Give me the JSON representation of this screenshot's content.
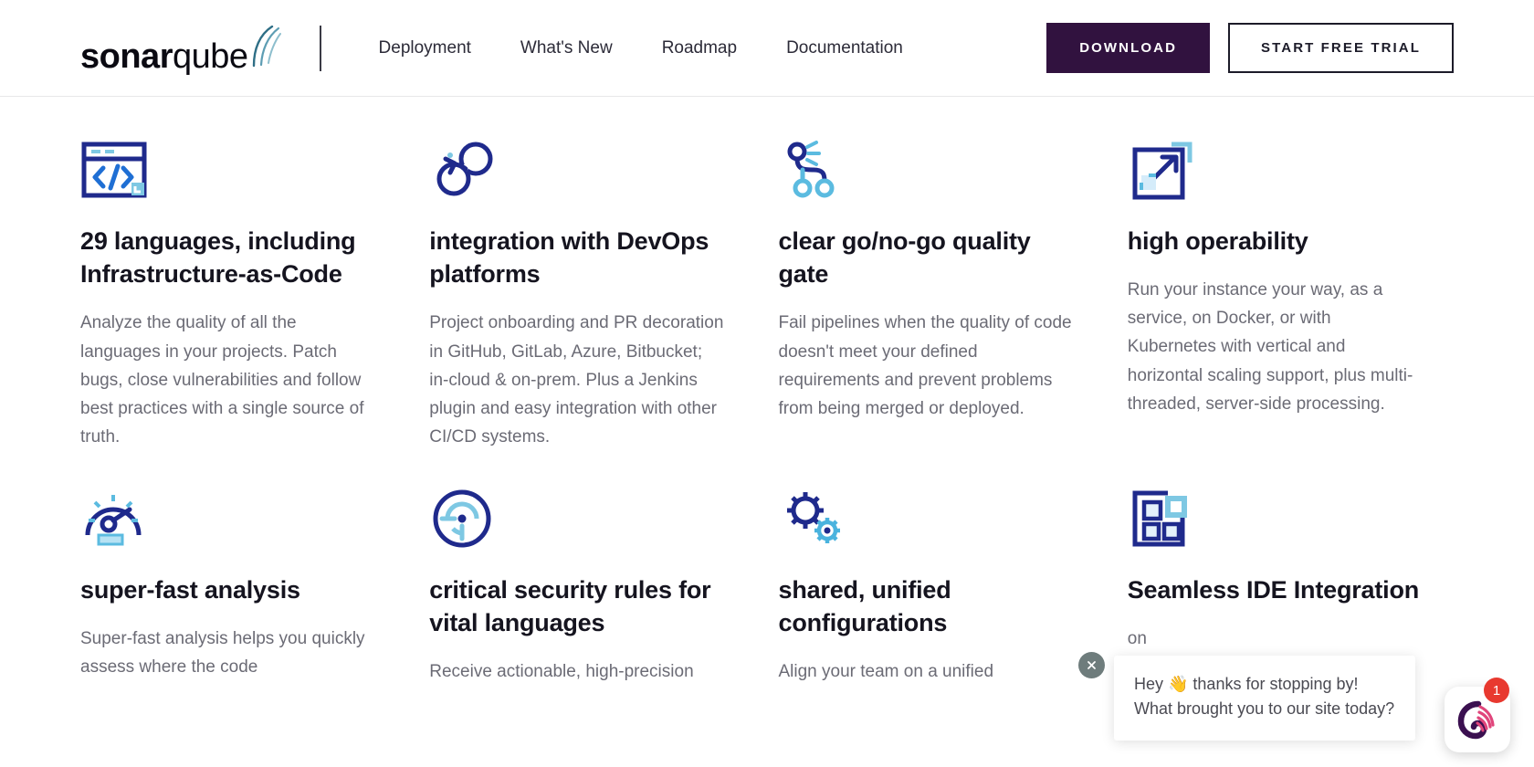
{
  "brand": {
    "logo_bold": "sonar",
    "logo_light": "qube",
    "logo_waves_icon": "signal-waves-icon"
  },
  "header": {
    "nav": [
      {
        "label": "Deployment",
        "name": "nav-item-deployment"
      },
      {
        "label": "What's New",
        "name": "nav-item-whats-new"
      },
      {
        "label": "Roadmap",
        "name": "nav-item-roadmap"
      },
      {
        "label": "Documentation",
        "name": "nav-item-documentation"
      }
    ],
    "download_label": "DOWNLOAD",
    "trial_label": "START FREE TRIAL",
    "primary_color": "#31123f",
    "secondary_border_color": "#1c1b29"
  },
  "features": [
    {
      "icon": "code-window-icon",
      "title": "29 languages, including Infrastructure-as-Code",
      "body": "Analyze the quality of all the languages in your projects. Patch bugs, close vulnerabilities and follow best practices with a single source of truth."
    },
    {
      "icon": "devops-infinity-loop-icon",
      "title": "integration with DevOps platforms",
      "body": "Project onboarding and PR decoration in GitHub, GitLab, Azure, Bitbucket; in-cloud & on-prem. Plus a Jenkins plugin and easy integration with other CI/CD systems."
    },
    {
      "icon": "pipeline-branch-icon",
      "title": "clear go/no-go quality gate",
      "body": "Fail pipelines when the quality of code doesn't meet your defined requirements and prevent problems from being merged or deployed."
    },
    {
      "icon": "expand-arrow-square-icon",
      "title": "high operability",
      "body": "Run your instance your way, as a service, on Docker, or with Kubernetes with vertical and horizontal scaling support, plus multi-threaded, server-side processing."
    },
    {
      "icon": "speedometer-gauge-icon",
      "title": "super-fast analysis",
      "body": "Super-fast analysis helps you quickly assess where the code"
    },
    {
      "icon": "target-crosshair-icon",
      "title": "critical security rules for vital languages",
      "body": "Receive actionable, high-precision"
    },
    {
      "icon": "gears-icon",
      "title": "shared, unified configurations",
      "body": "Align your team on a unified"
    },
    {
      "icon": "modules-grid-icon",
      "title": "Seamless IDE Integration",
      "body": "on"
    }
  ],
  "chat": {
    "message": "Hey 👋 thanks for stopping by! What brought you to our site today?",
    "close_icon": "close-icon",
    "launcher_icon": "drift-chat-logo-icon",
    "badge_count": "1",
    "badge_color": "#e8392f"
  }
}
